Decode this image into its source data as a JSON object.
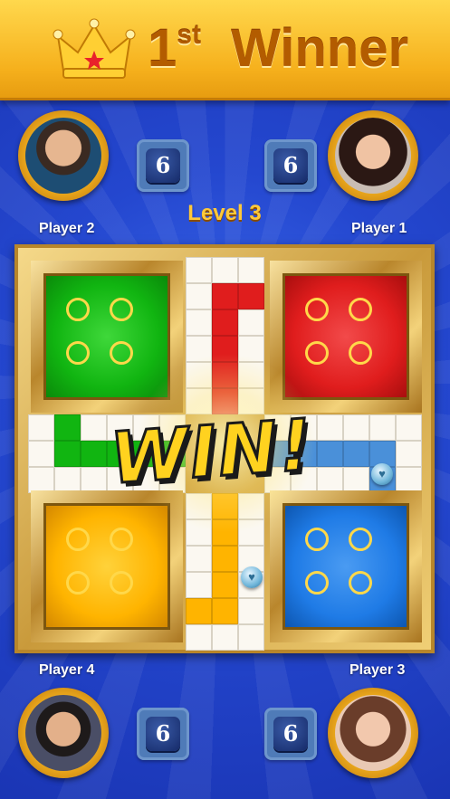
{
  "header": {
    "rank_number": "1",
    "rank_suffix": "st",
    "title": "Winner",
    "crown_icon": "crown-icon"
  },
  "level": "Level 3",
  "players": [
    {
      "name": "Player 2",
      "dice": "6"
    },
    {
      "name": "Player 1",
      "dice": "6"
    },
    {
      "name": "Player 4",
      "dice": "6"
    },
    {
      "name": "Player 3",
      "dice": "6"
    }
  ],
  "board": {
    "homes": [
      {
        "color_name": "green",
        "color": "#11b511"
      },
      {
        "color_name": "red",
        "color": "#e01d1d"
      },
      {
        "color_name": "yellow",
        "color": "#ffb400"
      },
      {
        "color_name": "blue",
        "color": "#1f7be6"
      }
    ],
    "token_icon": "heart-token-icon"
  },
  "banner": "WIN!"
}
